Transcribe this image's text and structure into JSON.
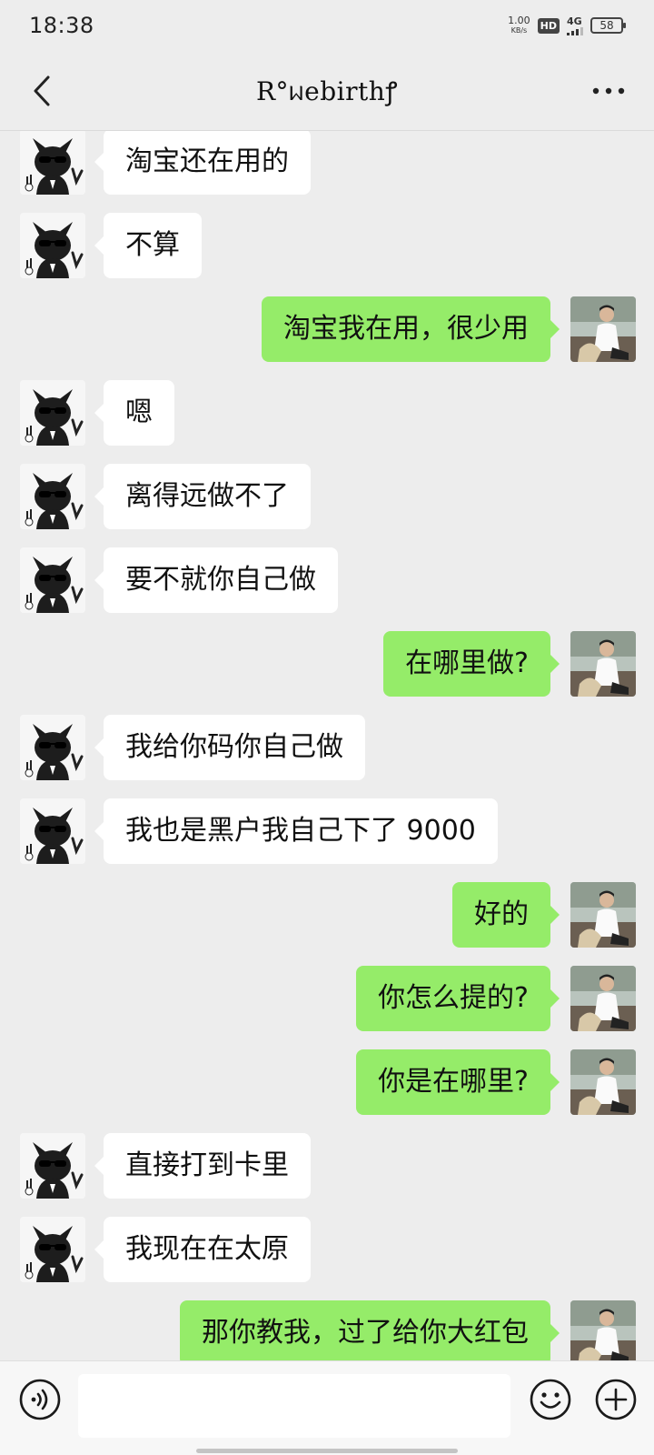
{
  "status_bar": {
    "time": "18:38",
    "net_speed_value": "1.00",
    "net_speed_unit": "KB/s",
    "hd_label": "HD",
    "network_label": "4G",
    "battery_level": "58"
  },
  "header": {
    "title": "R°ᥕebirthꝭ",
    "back_icon": "back-chevron-icon",
    "more_icon": "more-dots-icon"
  },
  "colors": {
    "background": "#ededed",
    "self_bubble": "#95ec69",
    "other_bubble": "#ffffff"
  },
  "messages": [
    {
      "side": "left",
      "text": "淘宝还在用的"
    },
    {
      "side": "left",
      "text": "不算"
    },
    {
      "side": "right",
      "text": "淘宝我在用，很少用"
    },
    {
      "side": "left",
      "text": "嗯"
    },
    {
      "side": "left",
      "text": "离得远做不了"
    },
    {
      "side": "left",
      "text": "要不就你自己做"
    },
    {
      "side": "right",
      "text": "在哪里做?"
    },
    {
      "side": "left",
      "text": "我给你码你自己做"
    },
    {
      "side": "left",
      "text": "我也是黑户我自己下了 9000"
    },
    {
      "side": "right",
      "text": "好的"
    },
    {
      "side": "right",
      "text": "你怎么提的?"
    },
    {
      "side": "right",
      "text": "你是在哪里?"
    },
    {
      "side": "left",
      "text": "直接打到卡里"
    },
    {
      "side": "left",
      "text": "我现在在太原"
    },
    {
      "side": "right",
      "text": "那你教我，过了给你大红包"
    }
  ],
  "input_bar": {
    "voice_icon": "voice-icon",
    "emoji_icon": "emoji-icon",
    "plus_icon": "plus-icon",
    "input_value": ""
  }
}
